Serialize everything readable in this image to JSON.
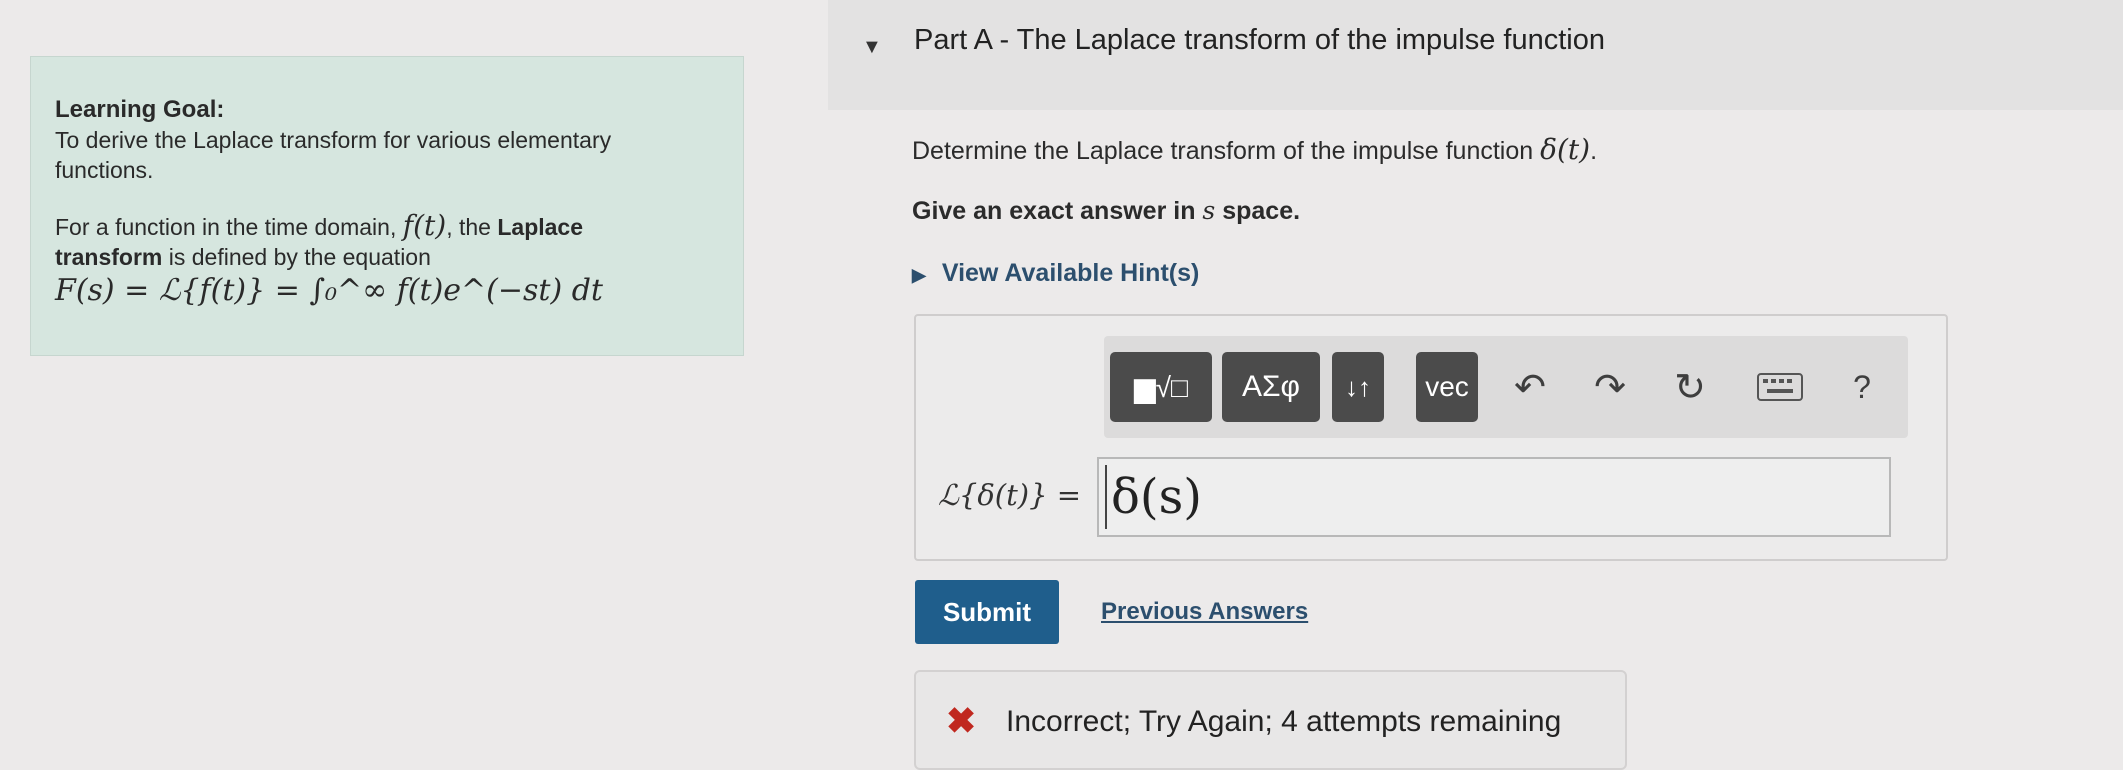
{
  "goal": {
    "heading": "Learning Goal:",
    "line1": "To derive the Laplace transform for various elementary",
    "line2": "functions.",
    "p2_line1_pre": "For a function in the time domain, ",
    "p2_line1_math": "f(t)",
    "p2_line1_post": ", the ",
    "p2_line1_bold": "Laplace",
    "p2_line2_bold": "transform",
    "p2_line2_post": " is defined by the equation",
    "equation": "F(s) = ℒ{f(t)} = ∫₀^∞ f(t)e^(−st) dt"
  },
  "part": {
    "toggle_icon": "caret-down-icon",
    "title": "Part A - The Laplace transform of the impulse function"
  },
  "question": {
    "text": "Determine the Laplace transform of the impulse function ",
    "math": "δ(t)",
    "end": ".",
    "instruction_pre": "Give an exact answer in ",
    "instruction_var": "s",
    "instruction_post": " space."
  },
  "hint": {
    "label": "View Available Hint(s)",
    "icon": "caret-right-icon"
  },
  "toolbar": {
    "templates_label": "▆√□",
    "symbols_label": "ΑΣφ",
    "arrows_label": "↓↑",
    "vec_label": "vec",
    "undo_icon": "undo-icon",
    "redo_icon": "redo-icon",
    "reset_icon": "reset-icon",
    "keyboard_icon": "keyboard-icon",
    "help_label": "?"
  },
  "answer": {
    "label": "ℒ{δ(t)} =",
    "value": "δ(s)"
  },
  "actions": {
    "submit_label": "Submit",
    "previous_answers_label": "Previous Answers"
  },
  "feedback": {
    "icon": "x-icon",
    "text": "Incorrect; Try Again; 4 attempts remaining"
  },
  "colors": {
    "goal_bg": "#d6e6df",
    "submit_bg": "#1f5e8c",
    "link": "#2c4f6e",
    "error": "#c0281f",
    "toolbar_button": "#4b4b4b"
  }
}
